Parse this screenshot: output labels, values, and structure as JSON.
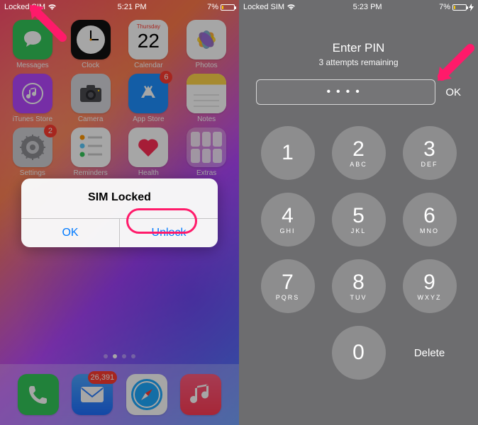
{
  "left": {
    "status": {
      "carrier": "Locked SIM",
      "time": "5:21 PM",
      "battery_pct": "7%"
    },
    "apps": [
      {
        "label": "Messages",
        "icon": "messages",
        "bg": "#34c759",
        "badge": null
      },
      {
        "label": "Clock",
        "icon": "clock",
        "bg": "#111",
        "badge": null
      },
      {
        "label": "Calendar",
        "icon": "calendar",
        "bg": "#fff",
        "badge": null,
        "day_label": "Thursday",
        "day_num": "22"
      },
      {
        "label": "Photos",
        "icon": "photos",
        "bg": "#fff",
        "badge": null
      },
      {
        "label": "iTunes Store",
        "icon": "itunes",
        "bg": "#b547ff",
        "badge": null
      },
      {
        "label": "Camera",
        "icon": "camera",
        "bg": "#d7d7de",
        "badge": null
      },
      {
        "label": "App Store",
        "icon": "appstore",
        "bg": "#1e90ff",
        "badge": "6"
      },
      {
        "label": "Notes",
        "icon": "notes",
        "bg": "#fff",
        "badge": null
      },
      {
        "label": "Settings",
        "icon": "settings",
        "bg": "#cfcfd4",
        "badge": "2"
      },
      {
        "label": "Reminders",
        "icon": "reminders",
        "bg": "#fff",
        "badge": null
      },
      {
        "label": "Health",
        "icon": "health",
        "bg": "#fff",
        "badge": null
      },
      {
        "label": "Extras",
        "icon": "folder",
        "bg": "rgba(255,255,255,0.3)",
        "badge": null
      }
    ],
    "dock": [
      {
        "label": "Phone",
        "icon": "phone",
        "bg": "#34c759",
        "badge": null
      },
      {
        "label": "Mail",
        "icon": "mail",
        "bg": "linear-gradient(#4aa5ff,#1e6fff)",
        "badge": "26,391"
      },
      {
        "label": "Safari",
        "icon": "safari",
        "bg": "#fff",
        "badge": null
      },
      {
        "label": "Music",
        "icon": "music",
        "bg": "linear-gradient(#ff5b7f,#ff3c55)",
        "badge": null
      }
    ],
    "alert": {
      "title": "SIM Locked",
      "ok": "OK",
      "unlock": "Unlock"
    }
  },
  "right": {
    "status": {
      "carrier": "Locked SIM",
      "time": "5:23 PM",
      "battery_pct": "7%"
    },
    "pin": {
      "title": "Enter PIN",
      "sub": "3 attempts remaining",
      "value": "••••",
      "ok": "OK",
      "delete": "Delete"
    },
    "keys": [
      {
        "n": "1",
        "l": ""
      },
      {
        "n": "2",
        "l": "ABC"
      },
      {
        "n": "3",
        "l": "DEF"
      },
      {
        "n": "4",
        "l": "GHI"
      },
      {
        "n": "5",
        "l": "JKL"
      },
      {
        "n": "6",
        "l": "MNO"
      },
      {
        "n": "7",
        "l": "PQRS"
      },
      {
        "n": "8",
        "l": "TUV"
      },
      {
        "n": "9",
        "l": "WXYZ"
      },
      {
        "n": "",
        "l": ""
      },
      {
        "n": "0",
        "l": ""
      }
    ]
  }
}
